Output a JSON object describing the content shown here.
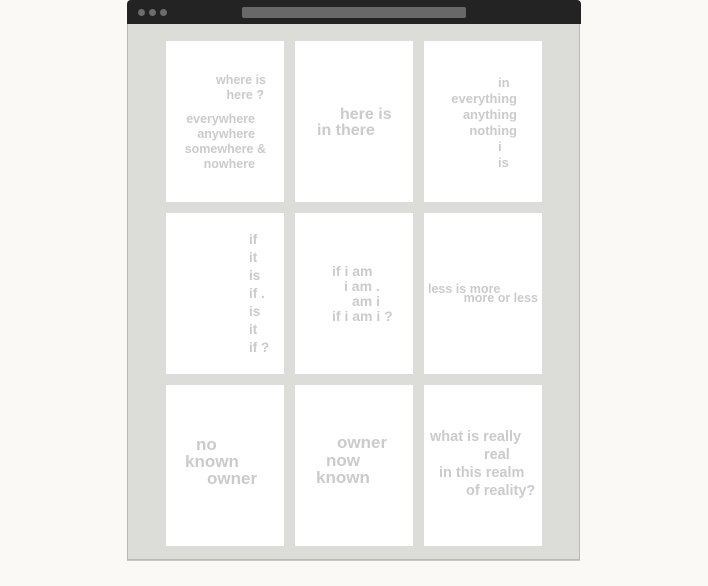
{
  "window": {
    "title_bar": {
      "controls": [
        "window-dot",
        "window-dot",
        "window-dot"
      ],
      "address_bar": ""
    }
  },
  "cards": [
    {
      "id": "where-is-here",
      "lines": [
        "where is",
        "here ?",
        "everywhere",
        "anywhere",
        "somewhere &",
        "nowhere"
      ]
    },
    {
      "id": "here-is-in-there",
      "lines": [
        "here is",
        "in there"
      ]
    },
    {
      "id": "in-everything",
      "lines": [
        "in",
        "everything",
        "anything",
        "nothing",
        "i",
        "is"
      ]
    },
    {
      "id": "if-it-is",
      "lines": [
        "if",
        "it",
        "is",
        "if .",
        "is",
        "it",
        "if ?"
      ]
    },
    {
      "id": "if-i-am",
      "lines": [
        "if i am",
        "i am .",
        "am i",
        "if i am i ?"
      ]
    },
    {
      "id": "less-is-more",
      "lines": [
        "less is more",
        "more or less"
      ]
    },
    {
      "id": "no-known-owner",
      "lines": [
        "no",
        "known",
        "owner"
      ]
    },
    {
      "id": "owner-now-known",
      "lines": [
        "owner",
        "now",
        "known"
      ]
    },
    {
      "id": "what-is-really-real",
      "lines": [
        "what is really",
        "real",
        "in this realm",
        "of reality?"
      ]
    }
  ],
  "colors": {
    "card_text": "#cbcbcb",
    "frame": "#dcdcd8",
    "titlebar": "#232323",
    "page_bg": "#faf9f6"
  }
}
